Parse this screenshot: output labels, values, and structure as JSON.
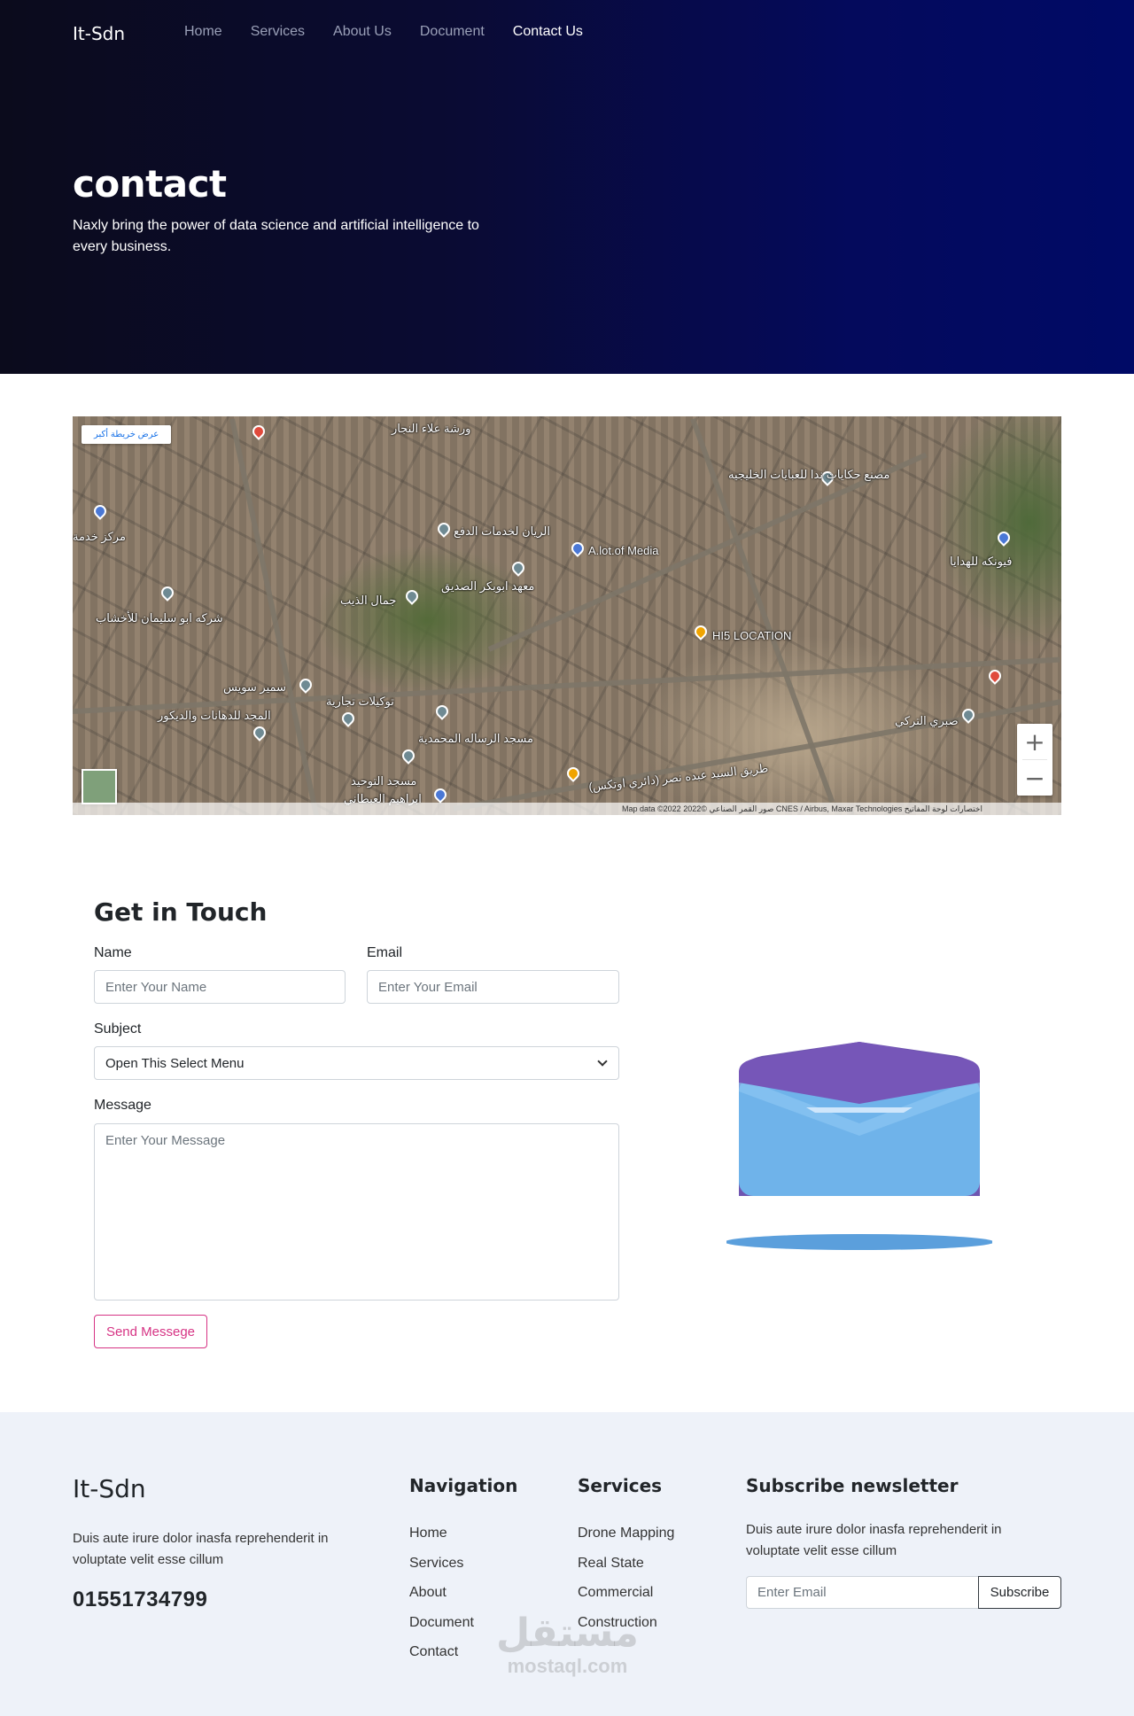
{
  "header": {
    "brand": "It-Sdn",
    "nav": [
      {
        "label": "Home",
        "active": false
      },
      {
        "label": "Services",
        "active": false
      },
      {
        "label": "About Us",
        "active": false
      },
      {
        "label": "Document",
        "active": false
      },
      {
        "label": "Contact Us",
        "active": true
      }
    ]
  },
  "hero": {
    "title": "contact",
    "subtitle": "Naxly bring the power of data science and artificial intelligence to every business."
  },
  "map": {
    "view_larger_link": "عرض خريطة أكبر",
    "labels": {
      "l1": "ورشة علاء النجار",
      "l2": "مصنع حكايات ندا للعبايات الخليجيه",
      "l3": "الريان لخدمات الدفع",
      "l4": "A.lot.of Media",
      "l5": "معهد ابوبكر الصديق",
      "l6": "جمال الذيب",
      "l7": "HI5 LOCATION",
      "l8": "شركه ابو سليمان للأخشاب",
      "l9": "سمير سويس",
      "l10": "توكيلات تجارية",
      "l11": "المجد للدهانات والديكور",
      "l12": "مسجد الرساله المحمدية",
      "l13": "مسجد التوحيد",
      "l14": "ابراهيم العبطاني",
      "l15": "صبري التركي",
      "l16": "مركز خدمة",
      "l17": "فيونكه للهدايا",
      "l18": "طريق السيد عبده نصر (دائري اوتكس)"
    },
    "zoom_in": "+",
    "zoom_out": "−",
    "attribution": "Map data ©2022 صور القمر الصناعي ©2022 CNES / Airbus, Maxar Technologies   اختصارات لوحة المفاتيح"
  },
  "contact": {
    "title": "Get in Touch",
    "name_label": "Name",
    "name_placeholder": "Enter Your Name",
    "email_label": "Email",
    "email_placeholder": "Enter Your Email",
    "subject_label": "Subject",
    "subject_selected": "Open This Select Menu",
    "message_label": "Message",
    "message_placeholder": "Enter Your Message",
    "send_label": "Send Messege"
  },
  "footer": {
    "brand": "It-Sdn",
    "description": "Duis aute irure dolor inasfa reprehenderit in voluptate velit esse cillum",
    "phone": "01551734799",
    "nav_title": "Navigation",
    "nav_items": [
      "Home",
      "Services",
      "About",
      "Document",
      "Contact"
    ],
    "services_title": "Services",
    "services_items": [
      "Drone Mapping",
      "Real State",
      "Commercial",
      "Construction"
    ],
    "newsletter_title": "Subscribe newsletter",
    "newsletter_desc": "Duis aute irure dolor inasfa reprehenderit in voluptate velit esse cillum",
    "email_placeholder": "Enter Email",
    "subscribe_label": "Subscribe",
    "watermark_ar": "مستقل",
    "watermark_en": "mostaql.com"
  },
  "colors": {
    "hero_start": "#0b0b1c",
    "hero_end": "#000a66",
    "accent_pink": "#d63384",
    "footer_bg": "#eef2f9"
  }
}
